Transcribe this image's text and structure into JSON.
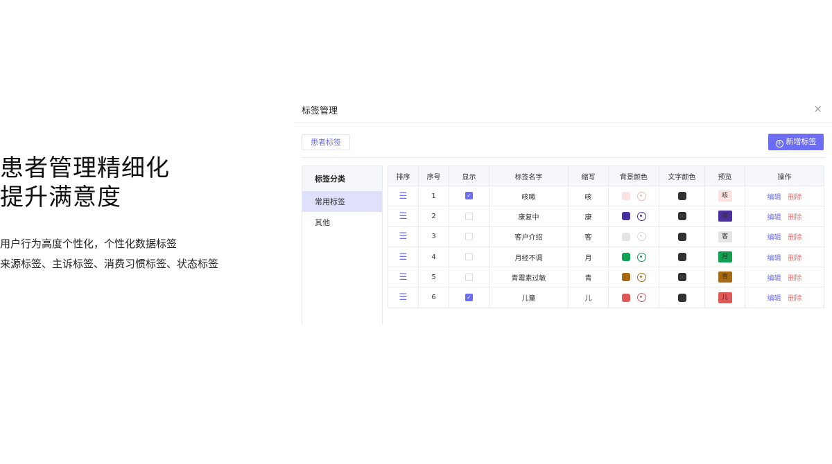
{
  "hero": {
    "title_line1": "患者管理精细化",
    "title_line2": "提升满意度",
    "desc_line1": "用户行为高度个性化，个性化数据标签",
    "desc_line2": "来源标签、主诉标签、消费习惯标签、状态标签"
  },
  "modal": {
    "title": "标签管理",
    "close": "×",
    "patient_tag_btn": "患者标签",
    "add_btn": "新增标签",
    "add_icon": "+"
  },
  "sidebar": {
    "header": "标签分类",
    "items": [
      {
        "label": "常用标签",
        "active": true
      },
      {
        "label": "其他",
        "active": false
      }
    ]
  },
  "table": {
    "columns": [
      "排序",
      "序号",
      "显示",
      "标签名字",
      "缩写",
      "背景颜色",
      "文字颜色",
      "预览",
      "操作"
    ],
    "drag_icon": "☰",
    "check_mark": "✓",
    "edit_label": "编辑",
    "delete_label": "删除",
    "rows": [
      {
        "index": "1",
        "show": true,
        "name": "咳嗽",
        "abbr": "咳",
        "bg": "#fde1e1",
        "text_color": "#333333",
        "palette_color": "#f4b8b8"
      },
      {
        "index": "2",
        "show": false,
        "name": "康复中",
        "abbr": "康",
        "bg": "#4a2fa0",
        "text_color": "#333333",
        "palette_color": "#4a2fa0"
      },
      {
        "index": "3",
        "show": false,
        "name": "客户介绍",
        "abbr": "客",
        "bg": "#e4e4e4",
        "text_color": "#333333",
        "palette_color": "#d8d8d8"
      },
      {
        "index": "4",
        "show": false,
        "name": "月经不调",
        "abbr": "月",
        "bg": "#0fa050",
        "text_color": "#333333",
        "palette_color": "#0fa050"
      },
      {
        "index": "5",
        "show": false,
        "name": "青霉素过敏",
        "abbr": "青",
        "bg": "#a86a10",
        "text_color": "#333333",
        "palette_color": "#a86a10"
      },
      {
        "index": "6",
        "show": true,
        "name": "儿童",
        "abbr": "儿",
        "bg": "#e05858",
        "text_color": "#333333",
        "palette_color": "#e05858"
      }
    ]
  }
}
